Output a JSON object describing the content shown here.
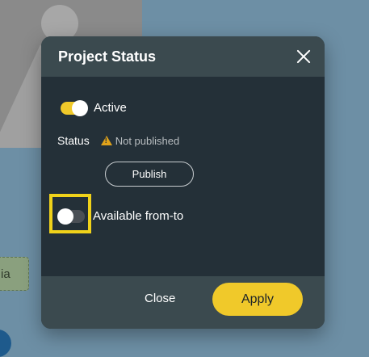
{
  "background": {
    "tag_text": "ia"
  },
  "modal": {
    "title": "Project Status",
    "active_toggle": {
      "label": "Active",
      "state": "on"
    },
    "status": {
      "label": "Status",
      "value": "Not published",
      "icon": "warning-icon"
    },
    "publish_label": "Publish",
    "available_toggle": {
      "label": "Available from-to",
      "state": "off"
    },
    "footer": {
      "close_label": "Close",
      "apply_label": "Apply"
    }
  },
  "colors": {
    "accent": "#f0c92a",
    "modal_bg": "#243038",
    "header_bg": "#3b4a4f",
    "page_bg": "#6d8fa5"
  }
}
